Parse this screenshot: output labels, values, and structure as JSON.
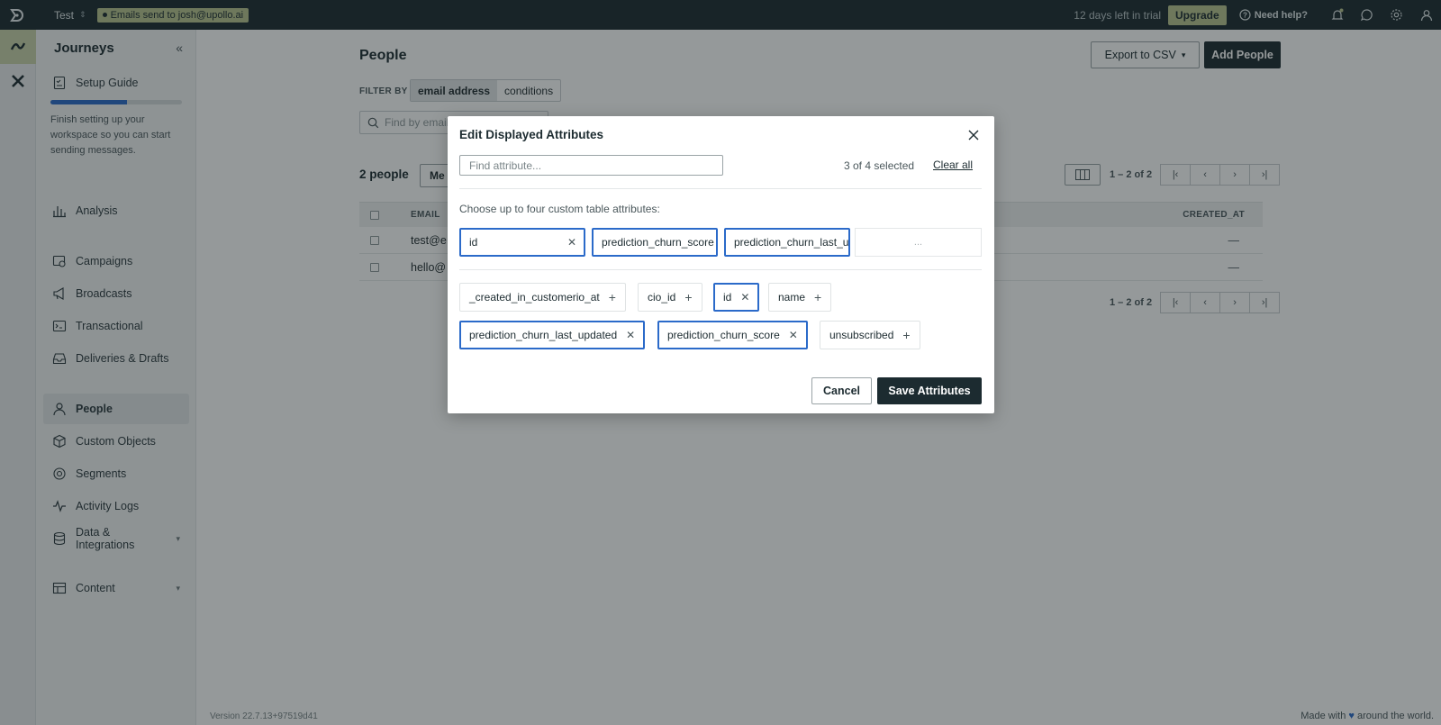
{
  "topbar": {
    "workspace": "Test",
    "env_badge": "Emails send to josh@upollo.ai",
    "trial": "12 days left in trial",
    "upgrade": "Upgrade",
    "help": "Need help?"
  },
  "sidebar": {
    "title": "Journeys",
    "setup_guide": "Setup Guide",
    "setup_progress": 0.58,
    "setup_desc": "Finish setting up your workspace so you can start sending messages.",
    "items": [
      {
        "label": "Analysis",
        "icon": "bar-chart-icon"
      },
      {
        "label": "Campaigns",
        "icon": "campaign-icon"
      },
      {
        "label": "Broadcasts",
        "icon": "megaphone-icon"
      },
      {
        "label": "Transactional",
        "icon": "terminal-icon"
      },
      {
        "label": "Deliveries & Drafts",
        "icon": "inbox-icon"
      },
      {
        "label": "People",
        "icon": "person-icon"
      },
      {
        "label": "Custom Objects",
        "icon": "cube-icon"
      },
      {
        "label": "Segments",
        "icon": "segments-icon"
      },
      {
        "label": "Activity Logs",
        "icon": "pulse-icon"
      },
      {
        "label": "Data & Integrations",
        "icon": "database-icon"
      },
      {
        "label": "Content",
        "icon": "table-icon"
      }
    ]
  },
  "footer": {
    "version": "Version 22.7.13+97519d41",
    "made_pre": "Made with",
    "made_post": "around the world."
  },
  "page": {
    "title": "People",
    "export_btn": "Export to CSV",
    "add_btn": "Add People",
    "filter_by": "FILTER BY",
    "filter_email": "email address",
    "filter_conditions": "conditions",
    "search_placeholder": "Find by email",
    "count": "2 people",
    "more_btn": "Me",
    "pager_info": "1 – 2 of 2",
    "col_email": "EMAIL",
    "col_created": "CREATED_AT",
    "rows": [
      {
        "email": "test@e",
        "created": "—"
      },
      {
        "email": "hello@",
        "created": "—"
      }
    ]
  },
  "modal": {
    "title": "Edit Displayed Attributes",
    "find_placeholder": "Find attribute...",
    "selected": "3 of 4 selected",
    "clear_all": "Clear all",
    "instruction": "Choose up to four custom table attributes:",
    "slots": [
      "id",
      "prediction_churn_score",
      "prediction_churn_last_updated"
    ],
    "empty_slot": "...",
    "chips": [
      {
        "label": "_created_in_customerio_at",
        "selected": false
      },
      {
        "label": "cio_id",
        "selected": false
      },
      {
        "label": "id",
        "selected": true
      },
      {
        "label": "name",
        "selected": false
      },
      {
        "label": "prediction_churn_last_updated",
        "selected": true
      },
      {
        "label": "prediction_churn_score",
        "selected": true
      },
      {
        "label": "unsubscribed",
        "selected": false
      }
    ],
    "cancel": "Cancel",
    "save": "Save Attributes"
  },
  "colors": {
    "topbar": "#1c2b30",
    "accent_blue": "#2b6ac9",
    "upgrade_green": "#b8c48f"
  }
}
